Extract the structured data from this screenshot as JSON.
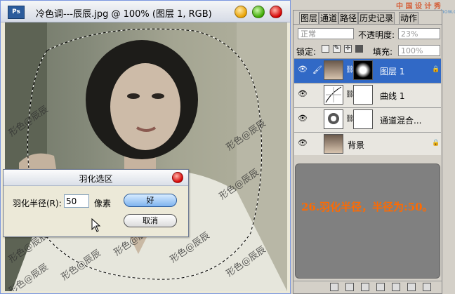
{
  "document": {
    "title": "冷色调---辰辰.jpg @ 100% (图层 1, RGB)",
    "app_icon": "ps-app-icon",
    "watermark": "形色@辰辰"
  },
  "dialog": {
    "title": "羽化选区",
    "radius_label": "羽化半径(R):",
    "radius_value": "50",
    "unit": "像素",
    "ok": "好",
    "cancel": "取消"
  },
  "site_logo": {
    "line1": "中 国 设 计 秀",
    "line2": "www.cnwebshow.com"
  },
  "layers_panel": {
    "tabs": [
      "图层",
      "通道",
      "路径",
      "历史记录",
      "动作"
    ],
    "active_tab": 0,
    "blend_mode": "正常",
    "opacity_label": "不透明度:",
    "opacity_value": "23%",
    "lock_label": "锁定:",
    "fill_label": "填充:",
    "fill_value": "100%",
    "layers": [
      {
        "name": "图层 1",
        "selected": true,
        "locked": true
      },
      {
        "name": "曲线 1",
        "selected": false,
        "locked": false
      },
      {
        "name": "通道混合...",
        "selected": false,
        "locked": false
      },
      {
        "name": "背景",
        "selected": false,
        "locked": true
      }
    ],
    "info_text": "26.羽化半径，半径为:50。"
  },
  "colors": {
    "selected_layer": "#3169c6",
    "info_text": "#ff6a00",
    "info_bg": "#808080"
  }
}
